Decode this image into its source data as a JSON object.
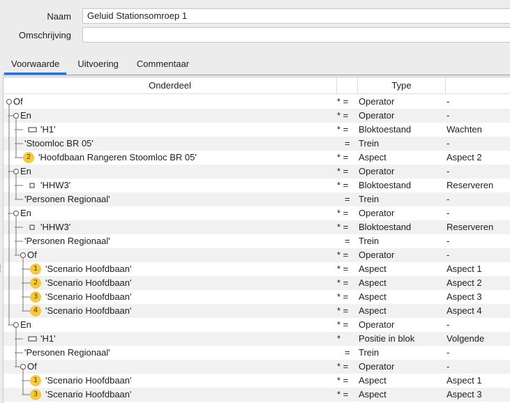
{
  "form": {
    "naam_label": "Naam",
    "naam_value": "Geluid Stationsomroep 1",
    "omschrijving_label": "Omschrijving",
    "omschrijving_value": ""
  },
  "tabs": [
    {
      "label": "Voorwaarde",
      "active": true
    },
    {
      "label": "Uitvoering",
      "active": false
    },
    {
      "label": "Commentaar",
      "active": false
    }
  ],
  "table": {
    "columns": {
      "name": "Onderdeel",
      "op": "",
      "type": "Type",
      "value": ""
    },
    "rows": [
      {
        "level": 0,
        "kind": "node",
        "label": "Of",
        "op": "* =",
        "type": "Operator",
        "value": "-"
      },
      {
        "level": 1,
        "kind": "node",
        "label": "En",
        "op": "* =",
        "type": "Operator",
        "value": "-"
      },
      {
        "level": 2,
        "kind": "block-rect",
        "label": "'H1'",
        "op": "* =",
        "type": "Bloktoestand",
        "value": "Wachten"
      },
      {
        "level": 2,
        "kind": "plain",
        "label": "'Stoomloc BR 05'",
        "op": "=",
        "type": "Trein",
        "value": "-"
      },
      {
        "level": 2,
        "kind": "badge",
        "badge": "2",
        "label": "'Hoofdbaan Rangeren Stoomloc BR 05'",
        "op": "* =",
        "type": "Aspect",
        "value": "Aspect 2",
        "last": true
      },
      {
        "level": 1,
        "kind": "node",
        "label": "En",
        "op": "* =",
        "type": "Operator",
        "value": "-"
      },
      {
        "level": 2,
        "kind": "block-square",
        "label": "'HHW3'",
        "op": "* =",
        "type": "Bloktoestand",
        "value": "Reserveren"
      },
      {
        "level": 2,
        "kind": "plain",
        "label": "'Personen Regionaal'",
        "op": "=",
        "type": "Trein",
        "value": "-",
        "last": true
      },
      {
        "level": 1,
        "kind": "node",
        "label": "En",
        "op": "* =",
        "type": "Operator",
        "value": "-"
      },
      {
        "level": 2,
        "kind": "block-square",
        "label": "'HHW3'",
        "op": "* =",
        "type": "Bloktoestand",
        "value": "Reserveren"
      },
      {
        "level": 2,
        "kind": "plain",
        "label": "'Personen Regionaal'",
        "op": "=",
        "type": "Trein",
        "value": "-"
      },
      {
        "level": 2,
        "kind": "node",
        "label": "Of",
        "op": "* =",
        "type": "Operator",
        "value": "-",
        "last": true
      },
      {
        "level": 3,
        "kind": "badge",
        "badge": "1",
        "label": "'Scenario Hoofdbaan'",
        "op": "* =",
        "type": "Aspect",
        "value": "Aspect 1"
      },
      {
        "level": 3,
        "kind": "badge",
        "badge": "2",
        "label": "'Scenario Hoofdbaan'",
        "op": "* =",
        "type": "Aspect",
        "value": "Aspect 2"
      },
      {
        "level": 3,
        "kind": "badge",
        "badge": "3",
        "label": "'Scenario Hoofdbaan'",
        "op": "* =",
        "type": "Aspect",
        "value": "Aspect 3"
      },
      {
        "level": 3,
        "kind": "badge",
        "badge": "4",
        "label": "'Scenario Hoofdbaan'",
        "op": "* =",
        "type": "Aspect",
        "value": "Aspect 4",
        "last": true
      },
      {
        "level": 1,
        "kind": "node",
        "label": "En",
        "op": "* =",
        "type": "Operator",
        "value": "-"
      },
      {
        "level": 2,
        "kind": "block-rect",
        "label": "'H1'",
        "op": "*",
        "type": "Positie in blok",
        "value": "Volgende"
      },
      {
        "level": 2,
        "kind": "plain",
        "label": "'Personen Regionaal'",
        "op": "=",
        "type": "Trein",
        "value": "-"
      },
      {
        "level": 2,
        "kind": "node",
        "label": "Of",
        "op": "* =",
        "type": "Operator",
        "value": "-",
        "last": true
      },
      {
        "level": 3,
        "kind": "badge",
        "badge": "1",
        "label": "'Scenario Hoofdbaan'",
        "op": "* =",
        "type": "Aspect",
        "value": "Aspect 1"
      },
      {
        "level": 3,
        "kind": "badge",
        "badge": "3",
        "label": "'Scenario Hoofdbaan'",
        "op": "* =",
        "type": "Aspect",
        "value": "Aspect 3",
        "last": true
      }
    ]
  },
  "colors": {
    "badge": "#f5c842",
    "accent": "#2a6fdb",
    "tree_line": "#8a6d00"
  }
}
